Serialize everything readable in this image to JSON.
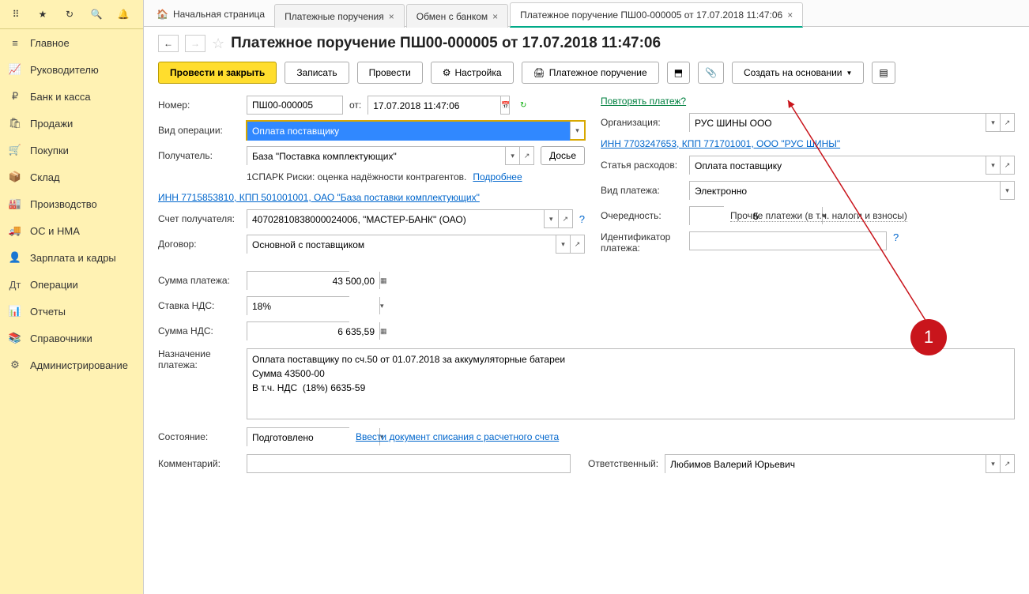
{
  "sidebar": {
    "items": [
      {
        "icon": "≡",
        "label": "Главное"
      },
      {
        "icon": "📈",
        "label": "Руководителю"
      },
      {
        "icon": "₽",
        "label": "Банк и касса"
      },
      {
        "icon": "🛍",
        "label": "Продажи"
      },
      {
        "icon": "🛒",
        "label": "Покупки"
      },
      {
        "icon": "📦",
        "label": "Склад"
      },
      {
        "icon": "🏭",
        "label": "Производство"
      },
      {
        "icon": "🚚",
        "label": "ОС и НМА"
      },
      {
        "icon": "👤",
        "label": "Зарплата и кадры"
      },
      {
        "icon": "Дт",
        "label": "Операции"
      },
      {
        "icon": "📊",
        "label": "Отчеты"
      },
      {
        "icon": "📚",
        "label": "Справочники"
      },
      {
        "icon": "⚙",
        "label": "Администрирование"
      }
    ]
  },
  "tabs": {
    "home": "Начальная страница",
    "items": [
      {
        "label": "Платежные поручения"
      },
      {
        "label": "Обмен с банком"
      },
      {
        "label": "Платежное поручение ПШ00-000005 от 17.07.2018 11:47:06",
        "active": true
      }
    ]
  },
  "page": {
    "title": "Платежное поручение ПШ00-000005 от 17.07.2018 11:47:06"
  },
  "toolbar": {
    "post_close": "Провести и закрыть",
    "save": "Записать",
    "post": "Провести",
    "settings": "Настройка",
    "print": "Платежное поручение",
    "create_based": "Создать на основании"
  },
  "form": {
    "number_lbl": "Номер:",
    "number": "ПШ00-000005",
    "from_lbl": "от:",
    "date": "17.07.2018 11:47:06",
    "repeat_link": "Повторять платеж?",
    "op_type_lbl": "Вид операции:",
    "op_type": "Оплата поставщику",
    "org_lbl": "Организация:",
    "org": "РУС ШИНЫ ООО",
    "recipient_lbl": "Получатель:",
    "recipient": "База \"Поставка комплектующих\"",
    "dossier": "Досье",
    "org_details": "ИНН 7703247653, КПП 771701001, ООО \"РУС ШИНЫ\"",
    "spark_text": "1СПАРК Риски: оценка надёжности контрагентов.",
    "spark_more": "Подробнее",
    "expense_lbl": "Статья расходов:",
    "expense": "Оплата поставщику",
    "recipient_details": "ИНН 7715853810, КПП 501001001, ОАО \"База поставки комплектующих\"",
    "pay_type_lbl": "Вид платежа:",
    "pay_type": "Электронно",
    "account_lbl": "Счет получателя:",
    "account": "40702810838000024006, \"МАСТЕР-БАНК\" (ОАО)",
    "priority_lbl": "Очередность:",
    "priority": "5",
    "priority_hint": "Прочие платежи (в т.ч. налоги и взносы)",
    "contract_lbl": "Договор:",
    "contract": "Основной с поставщиком",
    "id_lbl": "Идентификатор платежа:",
    "amount_lbl": "Сумма платежа:",
    "amount": "43 500,00",
    "vat_rate_lbl": "Ставка НДС:",
    "vat_rate": "18%",
    "vat_sum_lbl": "Сумма НДС:",
    "vat_sum": "6 635,59",
    "purpose_lbl": "Назначение платежа:",
    "purpose": "Оплата поставщику по сч.50 от 01.07.2018 за аккумуляторные батареи\nСумма 43500-00\nВ т.ч. НДС  (18%) 6635-59",
    "status_lbl": "Состояние:",
    "status": "Подготовлено",
    "status_link": "Ввести документ списания с расчетного счета",
    "comment_lbl": "Комментарий:",
    "responsible_lbl": "Ответственный:",
    "responsible": "Любимов Валерий Юрьевич"
  },
  "annotation": {
    "badge": "1"
  }
}
